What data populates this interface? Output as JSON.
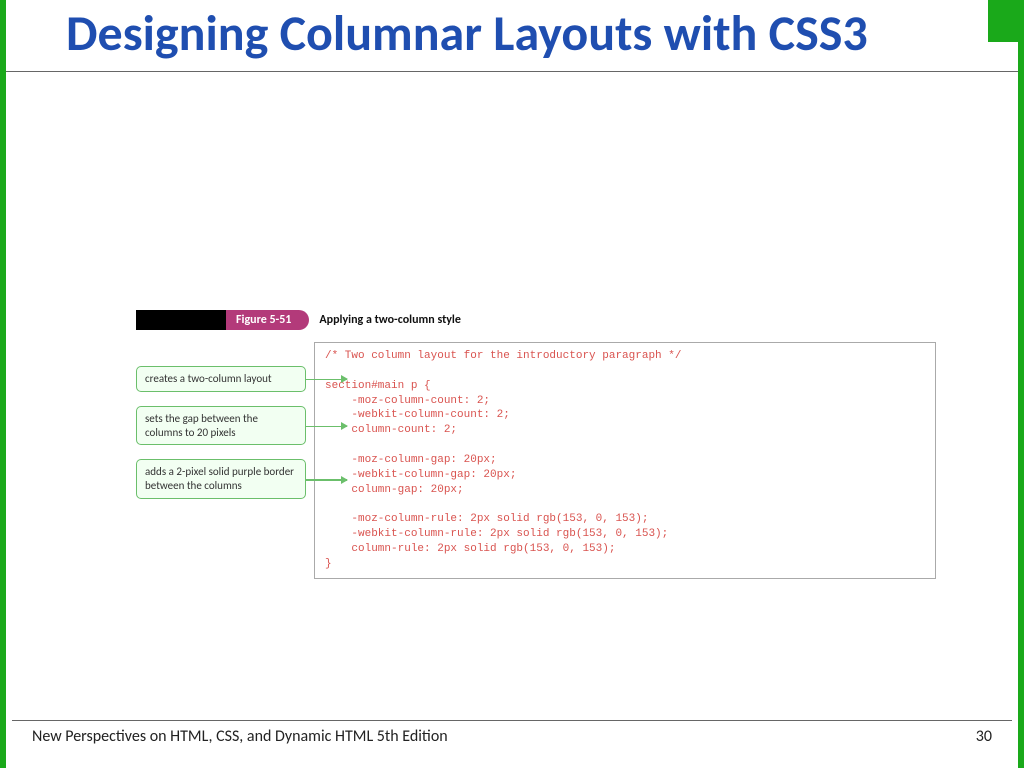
{
  "title": "Designing Columnar Layouts with CSS3",
  "figure": {
    "number": "Figure 5-51",
    "caption": "Applying a two-column style"
  },
  "callouts": {
    "c1": "creates a two-column layout",
    "c2": "sets the gap between the columns to 20 pixels",
    "c3": "adds a 2-pixel solid purple border between the columns"
  },
  "code": "/* Two column layout for the introductory paragraph */\n\nsection#main p {\n    -moz-column-count: 2;\n    -webkit-column-count: 2;\n    column-count: 2;\n\n    -moz-column-gap: 20px;\n    -webkit-column-gap: 20px;\n    column-gap: 20px;\n\n    -moz-column-rule: 2px solid rgb(153, 0, 153);\n    -webkit-column-rule: 2px solid rgb(153, 0, 153);\n    column-rule: 2px solid rgb(153, 0, 153);\n}",
  "footer": {
    "book": "New Perspectives on HTML, CSS, and Dynamic HTML 5th Edition",
    "page": "30"
  }
}
